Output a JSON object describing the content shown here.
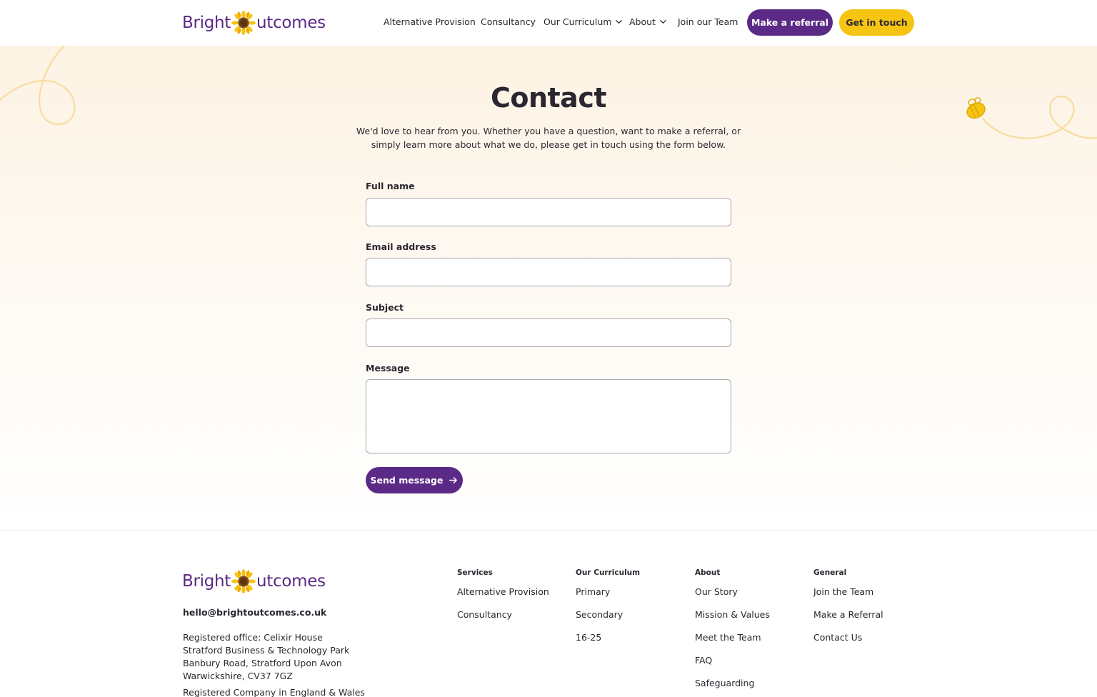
{
  "brand": {
    "logo_left": "Bright",
    "logo_right": "utcomes",
    "purple": "#5b2a86",
    "yellow": "#f6c413"
  },
  "nav": {
    "items": [
      {
        "label": "Alternative Provision"
      },
      {
        "label": "Consultancy"
      },
      {
        "label": "Our Curriculum"
      },
      {
        "label": "About"
      },
      {
        "label": "Join our Team"
      }
    ],
    "referral_button": "Make a referral",
    "touch_button": "Get in touch"
  },
  "contact": {
    "title": "Contact",
    "intro": "We'd love to hear from you. Whether you have a question, want to make a referral, or simply learn more about what we do, please get in touch using the form below.",
    "fields": {
      "name_label": "Full name",
      "name_value": "",
      "email_label": "Email address",
      "email_value": "",
      "subject_label": "Subject",
      "subject_value": "",
      "message_label": "Message",
      "message_value": ""
    },
    "submit_label": "Send message"
  },
  "footer": {
    "email": "hello@brightoutcomes.co.uk",
    "address_lines": [
      "Registered office: Celixir House",
      "Stratford Business & Technology Park",
      "Banbury Road, Stratford Upon Avon",
      "Warwickshire, CV37 7GZ"
    ],
    "registered": "Registered Company in England & Wales",
    "columns": [
      {
        "heading": "Services",
        "links": [
          "Alternative Provision",
          "Consultancy"
        ]
      },
      {
        "heading": "Our Curriculum",
        "links": [
          "Primary",
          "Secondary",
          "16-25"
        ]
      },
      {
        "heading": "About",
        "links": [
          "Our Story",
          "Mission & Values",
          "Meet the Team",
          "FAQ",
          "Safeguarding"
        ]
      },
      {
        "heading": "General",
        "links": [
          "Join the Team",
          "Make a Referral",
          "Contact Us"
        ]
      }
    ]
  }
}
